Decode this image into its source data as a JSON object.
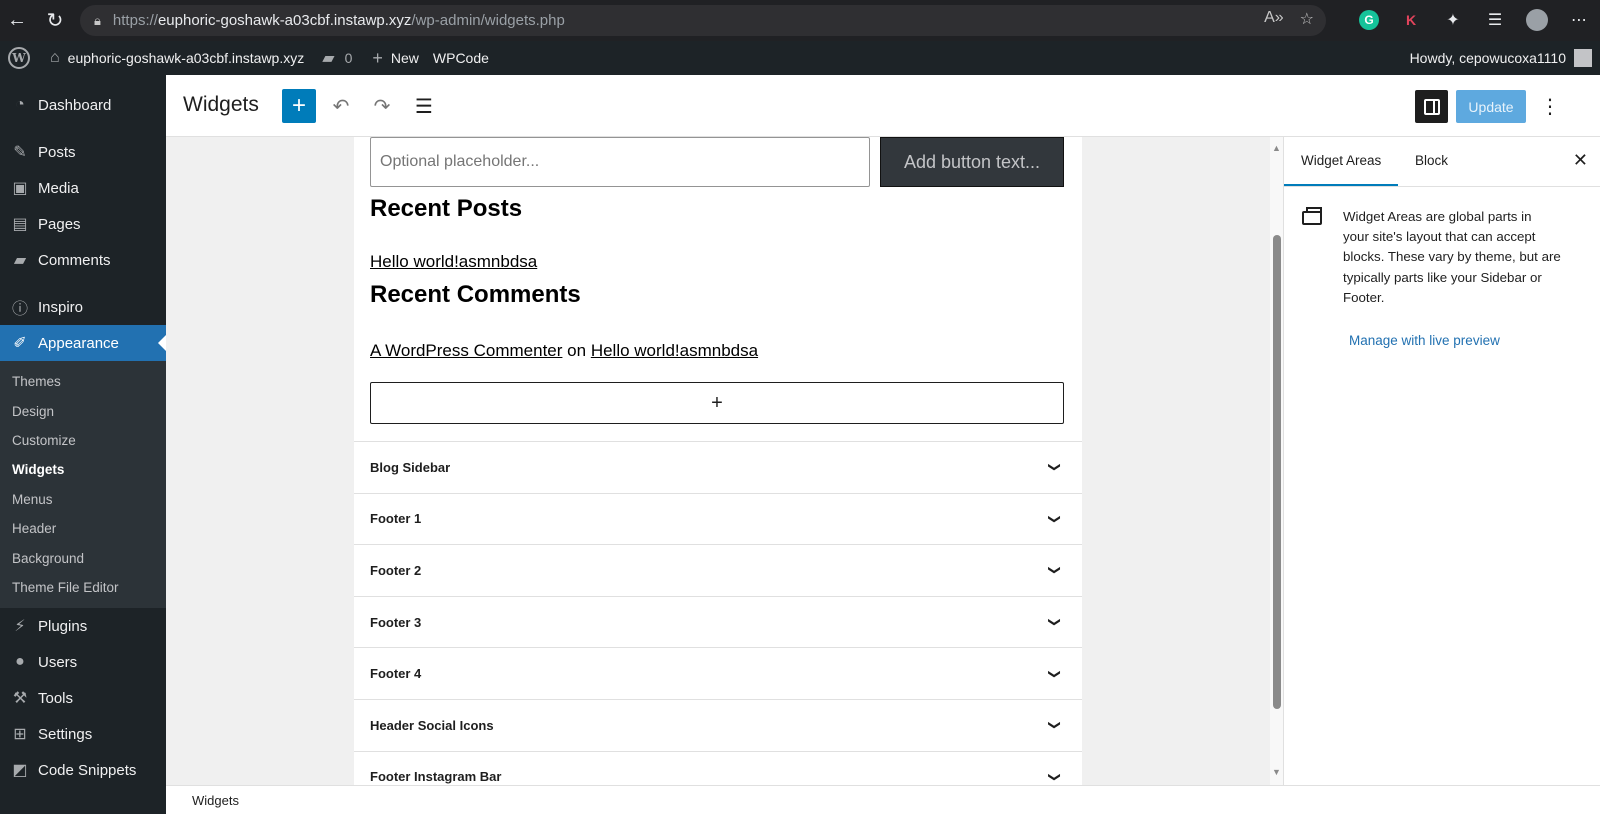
{
  "browser": {
    "url_prefix": "https://",
    "url_host": "euphoric-goshawk-a03cbf.instawp.xyz",
    "url_path": "/wp-admin/widgets.php",
    "extension_g": "G",
    "extension_k": "K"
  },
  "adminbar": {
    "wp_logo": "W",
    "site_name": "euphoric-goshawk-a03cbf.instawp.xyz",
    "comments_count": "0",
    "new_label": "New",
    "wpcode_label": "WPCode",
    "howdy": "Howdy, cepowucoxa1110"
  },
  "sidebar": {
    "items_top": [
      {
        "label": "Dashboard",
        "icon": "dashboard-icon"
      },
      {
        "label": "Posts",
        "icon": "pin-icon"
      },
      {
        "label": "Media",
        "icon": "media-icon"
      },
      {
        "label": "Pages",
        "icon": "pages-icon"
      },
      {
        "label": "Comments",
        "icon": "comment-icon"
      },
      {
        "label": "Inspiro",
        "icon": "info-icon"
      }
    ],
    "active": {
      "label": "Appearance",
      "icon": "brush-icon"
    },
    "submenu": [
      "Themes",
      "Design",
      "Customize",
      "Widgets",
      "Menus",
      "Header",
      "Background",
      "Theme File Editor"
    ],
    "current_submenu": "Widgets",
    "items_bottom": [
      {
        "label": "Plugins",
        "icon": "plug-icon"
      },
      {
        "label": "Users",
        "icon": "user-icon"
      },
      {
        "label": "Tools",
        "icon": "wrench-icon"
      },
      {
        "label": "Settings",
        "icon": "settings-icon"
      },
      {
        "label": "Code Snippets",
        "icon": "code-icon"
      }
    ]
  },
  "header": {
    "title": "Widgets",
    "add_label": "+",
    "update_label": "Update"
  },
  "canvas": {
    "search_placeholder": "Optional placeholder...",
    "search_button": "Add button text...",
    "recent_posts_heading": "Recent Posts",
    "recent_post_link": "Hello world!asmnbdsa",
    "recent_comments_heading": "Recent Comments",
    "comment_author": "A WordPress Commenter",
    "comment_on": "on",
    "comment_post": "Hello world!asmnbdsa",
    "appender_label": "+",
    "widget_areas": [
      "Blog Sidebar",
      "Footer 1",
      "Footer 2",
      "Footer 3",
      "Footer 4",
      "Header Social Icons",
      "Footer Instagram Bar"
    ]
  },
  "settings_panel": {
    "tab_widget_areas": "Widget Areas",
    "tab_block": "Block",
    "description": "Widget Areas are global parts in your site's layout that can accept blocks. These vary by theme, but are typically parts like your Sidebar or Footer.",
    "live_preview": "Manage with live preview"
  },
  "footer": {
    "breadcrumb": "Widgets"
  },
  "colors": {
    "admin_dark": "#1d2327",
    "accent": "#2271b1",
    "wp_blue": "#007cba"
  }
}
